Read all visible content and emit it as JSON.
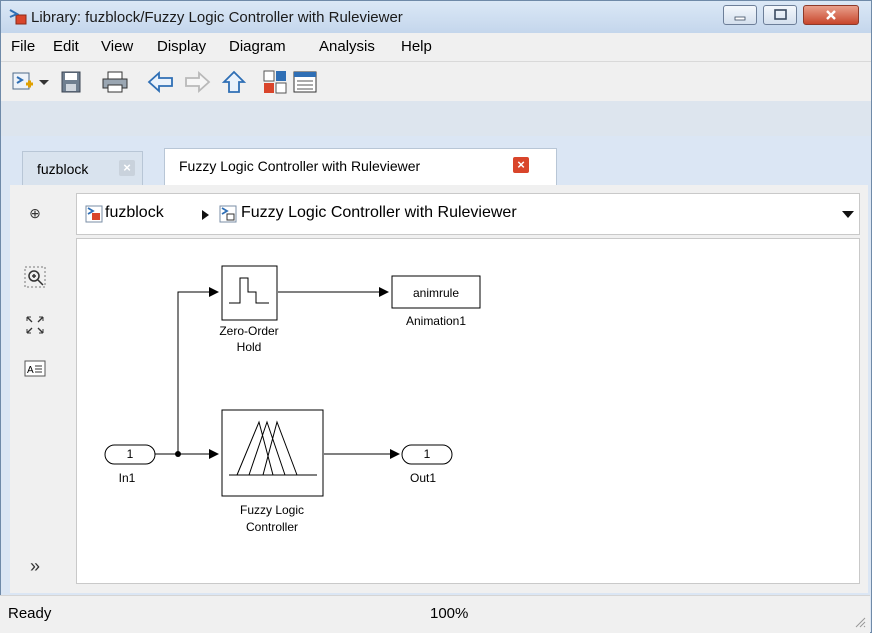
{
  "window": {
    "title": "Library: fuzblock/Fuzzy Logic  Controller  with Ruleviewer"
  },
  "menu": [
    "File",
    "Edit",
    "View",
    "Display",
    "Diagram",
    "Analysis",
    "Help"
  ],
  "tabs": [
    {
      "label": "fuzblock",
      "active": false
    },
    {
      "label": "Fuzzy Logic  Controller  with Ruleviewer",
      "active": true
    }
  ],
  "breadcrumb": {
    "root": "fuzblock",
    "current": "Fuzzy Logic  Controller  with Ruleviewer"
  },
  "diagram": {
    "inport_number": "1",
    "inport_label": "In1",
    "zoh_label_line1": "Zero-Order",
    "zoh_label_line2": "Hold",
    "animation_block_text": "animrule",
    "animation_label": "Animation1",
    "flc_label_line1": "Fuzzy Logic",
    "flc_label_line2": "Controller",
    "outport_number": "1",
    "outport_label": "Out1"
  },
  "status": {
    "state": "Ready",
    "zoom": "100%"
  },
  "colors": {
    "accent_red": "#d9452b",
    "title_bar": "#c4d6ec",
    "icon_blue": "#2f6fb5"
  }
}
